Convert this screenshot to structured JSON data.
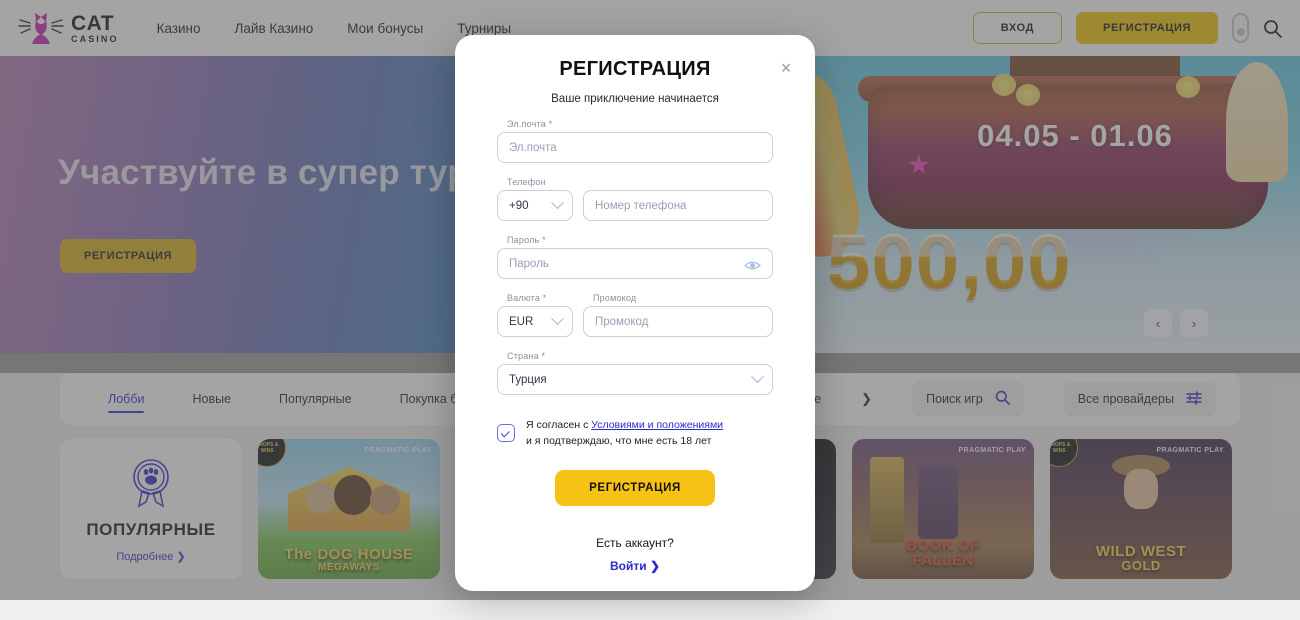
{
  "header": {
    "logo": {
      "line1": "CAT",
      "line2": "CASINO",
      "color": "#c724b1"
    },
    "nav": [
      {
        "label": "Казино"
      },
      {
        "label": "Лайв Казино"
      },
      {
        "label": "Мои бонусы"
      },
      {
        "label": "Турниры"
      }
    ],
    "login_label": "ВХОД",
    "register_label": "РЕГИСТРАЦИЯ",
    "theme_toggle_name": "theme-toggle-icon",
    "search_name": "search-icon"
  },
  "hero": {
    "title": "Участвуйте в супер турни",
    "cta_label": "РЕГИСТРАЦИЯ",
    "banner_date": "04.05 - 01.06",
    "banner_amount": "€ 500,00",
    "prev_icon": "‹",
    "next_icon": "›"
  },
  "tabs": {
    "items": [
      {
        "label": "Лобби",
        "active": true
      },
      {
        "label": "Новые",
        "active": false
      },
      {
        "label": "Популярные",
        "active": false
      },
      {
        "label": "Покупка бонуса",
        "active": false
      },
      {
        "label": "Настольные",
        "active": false
      }
    ],
    "search_label": "Поиск игр",
    "providers_label": "Все провайдеры"
  },
  "cards": [
    {
      "kind": "promo",
      "title": "ПОПУЛЯРНЫЕ",
      "more_label": "Подробнее",
      "icon": "paw-badge-icon"
    },
    {
      "kind": "game",
      "name": "The DOG HOUSE",
      "sub": "MEGAWAYS",
      "provider": "PRAGMATIC PLAY",
      "badge": "DROPS & WINS"
    },
    {
      "kind": "game",
      "name": "",
      "sub": "",
      "provider": "",
      "badge": ""
    },
    {
      "kind": "game",
      "name": "",
      "sub": "",
      "provider": "",
      "badge": ""
    },
    {
      "kind": "game",
      "name": "BOOK OF",
      "sub": "FALLEN",
      "provider": "PRAGMATIC PLAY",
      "badge": ""
    },
    {
      "kind": "game",
      "name": "WILD WEST",
      "sub": "GOLD",
      "provider": "PRAGMATIC PLAY",
      "badge": "DROPS & WINS"
    }
  ],
  "modal": {
    "title": "РЕГИСТРАЦИЯ",
    "subtitle": "Ваше приключение начинается",
    "close_icon": "×",
    "email": {
      "label": "Эл.почта *",
      "placeholder": "Эл.почта",
      "value": ""
    },
    "phone": {
      "label": "Телефон",
      "code_value": "+90",
      "number_placeholder": "Номер телефона",
      "number_value": ""
    },
    "password": {
      "label": "Пароль *",
      "placeholder": "Пароль",
      "value": "",
      "toggle_icon": "eye-icon"
    },
    "currency": {
      "label": "Валюта *",
      "value": "EUR"
    },
    "promo": {
      "label": "Промокод",
      "placeholder": "Промокод",
      "value": ""
    },
    "country": {
      "label": "Страна *",
      "value": "Турция"
    },
    "agreement": {
      "prefix": "Я согласен с ",
      "link": "Условиями и положениями",
      "suffix": "и я подтверждаю, что мне есть 18 лет",
      "checked": true
    },
    "submit_label": "РЕГИСТРАЦИЯ",
    "have_account": "Есть аккаунт?",
    "login_link": "Войти ❯"
  }
}
